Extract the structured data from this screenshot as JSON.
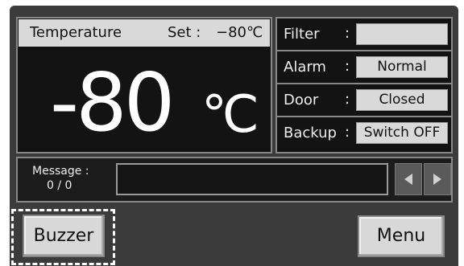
{
  "temperature_panel": {
    "label": "Temperature",
    "set_label": "Set :",
    "set_value": "−80℃",
    "current_value": "-80",
    "unit": "℃"
  },
  "status": {
    "colon": ":",
    "items": [
      {
        "name": "Filter",
        "value": ""
      },
      {
        "name": "Alarm",
        "value": "Normal"
      },
      {
        "name": "Door",
        "value": "Closed"
      },
      {
        "name": "Backup",
        "value": "Switch OFF"
      }
    ]
  },
  "message": {
    "label": "Message :",
    "count": "0 / 0",
    "text": ""
  },
  "buttons": {
    "buzzer": "Buzzer",
    "menu": "Menu"
  },
  "icons": {
    "prev": "triangle-left-icon",
    "next": "triangle-right-icon"
  }
}
